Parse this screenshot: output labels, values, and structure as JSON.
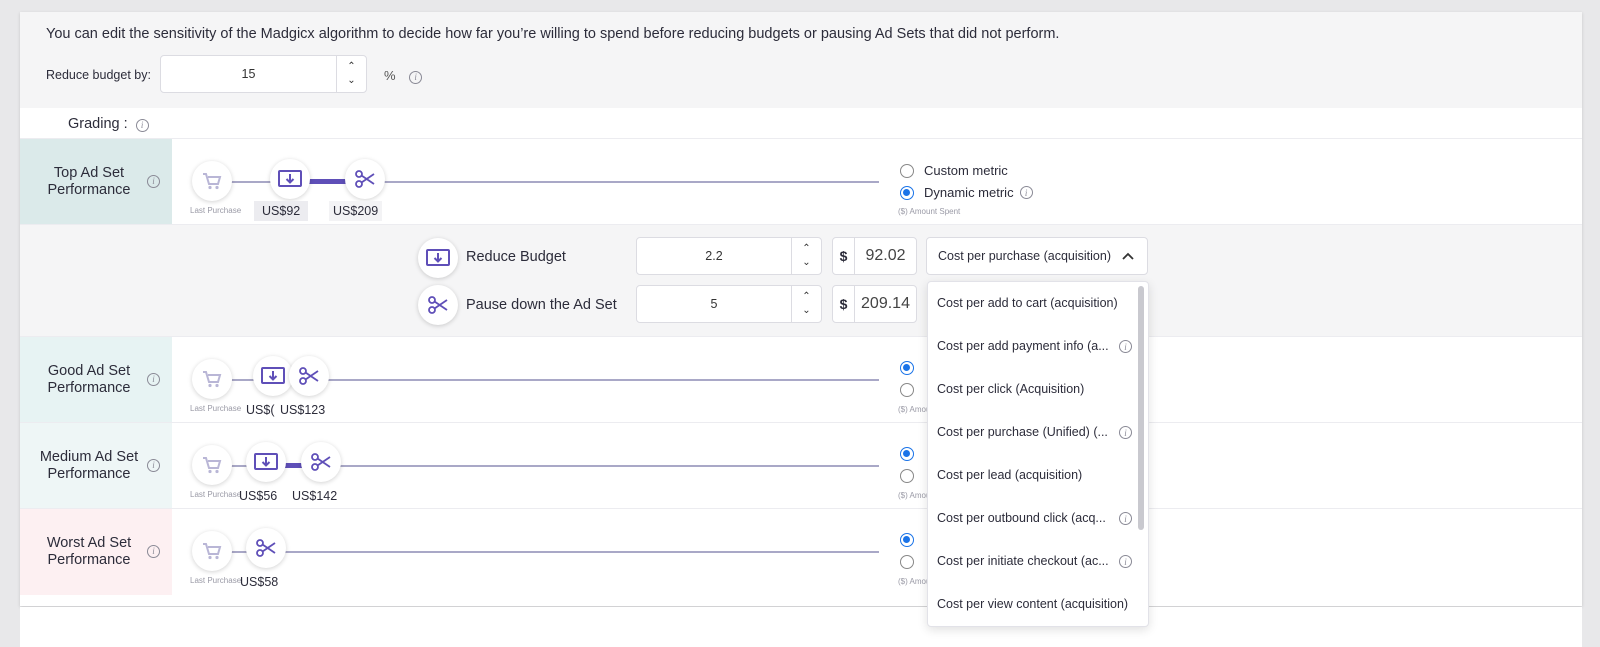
{
  "header": {
    "intro": "You can edit the sensitivity of the Madgicx algorithm to decide how far you’re willing to spend before reducing budgets or pausing Ad Sets that did not perform.",
    "reduce_label": "Reduce budget by:",
    "reduce_value": "15",
    "percent": "%"
  },
  "grading": {
    "label": "Grading :"
  },
  "rows": {
    "top": {
      "label": "Top Ad Set Performance",
      "last_purchase": "Last Purchase",
      "amt1": "US$92",
      "amt2": "US$209",
      "amount_spent": "($) Amount Spent",
      "radio_custom": "Custom metric",
      "radio_dynamic": "Dynamic metric",
      "selected": "dynamic"
    },
    "good": {
      "label": "Good Ad Set Performance",
      "last_purchase": "Last Purchase",
      "amt1": "US$(",
      "amt2": "US$123",
      "amount_spent": "($) Amou"
    },
    "medium": {
      "label": "Medium Ad Set Performance",
      "last_purchase": "Last Purchase",
      "amt1": "US$56",
      "amt2": "US$142",
      "amount_spent": "($) Amou"
    },
    "worst": {
      "label": "Worst Ad Set Performance",
      "last_purchase": "Last Purchase",
      "amt1": "US$58",
      "amount_spent": "($) Amou"
    }
  },
  "actions": {
    "reduce": {
      "label": "Reduce Budget",
      "multiplier": "2.2",
      "currency": "$",
      "amount": "92.02"
    },
    "pause": {
      "label": "Pause down the Ad Set",
      "multiplier": "5",
      "currency": "$",
      "amount": "209.14"
    }
  },
  "metric_select": {
    "selected": "Cost per purchase (acquisition)",
    "options": [
      "Cost per add to cart (acquisition)",
      "Cost per add payment info (a...",
      "Cost per click (Acquisition)",
      "Cost per purchase (Unified) (...",
      "Cost per lead (acquisition)",
      "Cost per outbound click (acq...",
      "Cost per initiate checkout (ac...",
      "Cost per view content (acquisition)"
    ]
  },
  "colors": {
    "accent": "#5f4fb8",
    "top_bg": "#dbeaea",
    "good_bg": "#e7f3f3",
    "medium_bg": "#eef6f6",
    "worst_bg": "#fdf0f2",
    "radio": "#1a73e8"
  },
  "icons": [
    "cart-icon",
    "money-down-icon",
    "scissors-icon",
    "info-icon",
    "chevron-up-icon",
    "chevron-down-icon"
  ]
}
